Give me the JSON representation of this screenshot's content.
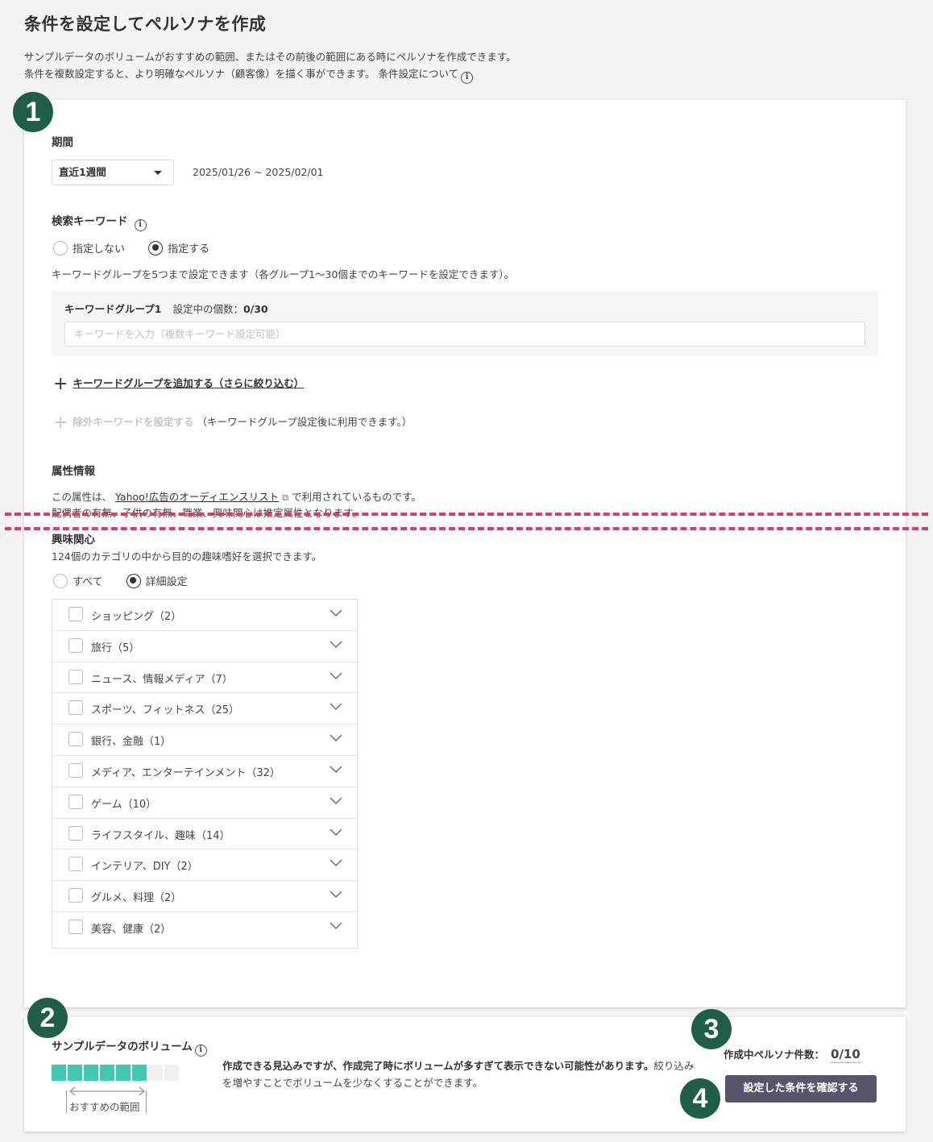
{
  "header": {
    "title": "条件を設定してペルソナを作成",
    "desc_line1": "サンプルデータのボリュームがおすすめの範囲、またはその前後の範囲にある時にペルソナを作成できます。",
    "desc_line2": "条件を複数設定すると、より明確なペルソナ（顧客像）を描く事ができます。 条件設定について"
  },
  "steps": [
    "1",
    "2",
    "3",
    "4"
  ],
  "period": {
    "label": "期間",
    "selected": "直近1週間",
    "range": "2025/01/26 ~ 2025/02/01"
  },
  "keyword": {
    "label": "検索キーワード",
    "options": [
      "指定しない",
      "指定する"
    ],
    "selected_index": 1,
    "note": "キーワードグループを5つまで設定できます（各グループ1〜30個までのキーワードを設定できます）。",
    "group_title": "キーワードグループ1",
    "group_count_label": "設定中の個数：",
    "group_count": "0/30",
    "input_placeholder": "キーワードを入力（複数キーワード設定可能）",
    "add_group_link": "キーワードグループを追加する（さらに絞り込む）",
    "exclude_link": "除外キーワードを設定する",
    "exclude_note": "（キーワードグループ設定後に利用できます。）"
  },
  "attributes": {
    "label": "属性情報",
    "desc_prefix": "この属性は、",
    "desc_link": "Yahoo!広告のオーディエンスリスト",
    "desc_suffix": "で利用されているものです。",
    "desc_line2": "配偶者の有無、子供の有無、職業、興味関心は推定属性となります。"
  },
  "interest": {
    "label": "興味関心",
    "desc": "124個のカテゴリの中から目的の趣味嗜好を選択できます。",
    "options": [
      "すべて",
      "詳細設定"
    ],
    "selected_index": 1,
    "categories": [
      "ショッピング（2）",
      "旅行（5）",
      "ニュース、情報メディア（7）",
      "スポーツ、フィットネス（25）",
      "銀行、金融（1）",
      "メディア、エンターテインメント（32）",
      "ゲーム（10）",
      "ライフスタイル、趣味（14）",
      "インテリア、DIY（2）",
      "グルメ、料理（2）",
      "美容、健康（2）"
    ]
  },
  "volume": {
    "label": "サンプルデータのボリューム",
    "filled_segments": 6,
    "total_segments": 8,
    "recommended_label": "おすすめの範囲",
    "warning_bold": "作成できる見込みですが、作成完了時にボリュームが多すぎて表示できない可能性があります。",
    "warning_rest": "絞り込みを増やすことでボリュームを少なくすることができます。"
  },
  "persona": {
    "count_label": "作成中ペルソナ件数：",
    "count": "0/10",
    "confirm_button": "設定した条件を確認する"
  },
  "colors": {
    "badge": "#1f5e48",
    "volume_fill": "#3fc9b0",
    "dash": "#e03a68",
    "button": "#56556a"
  }
}
